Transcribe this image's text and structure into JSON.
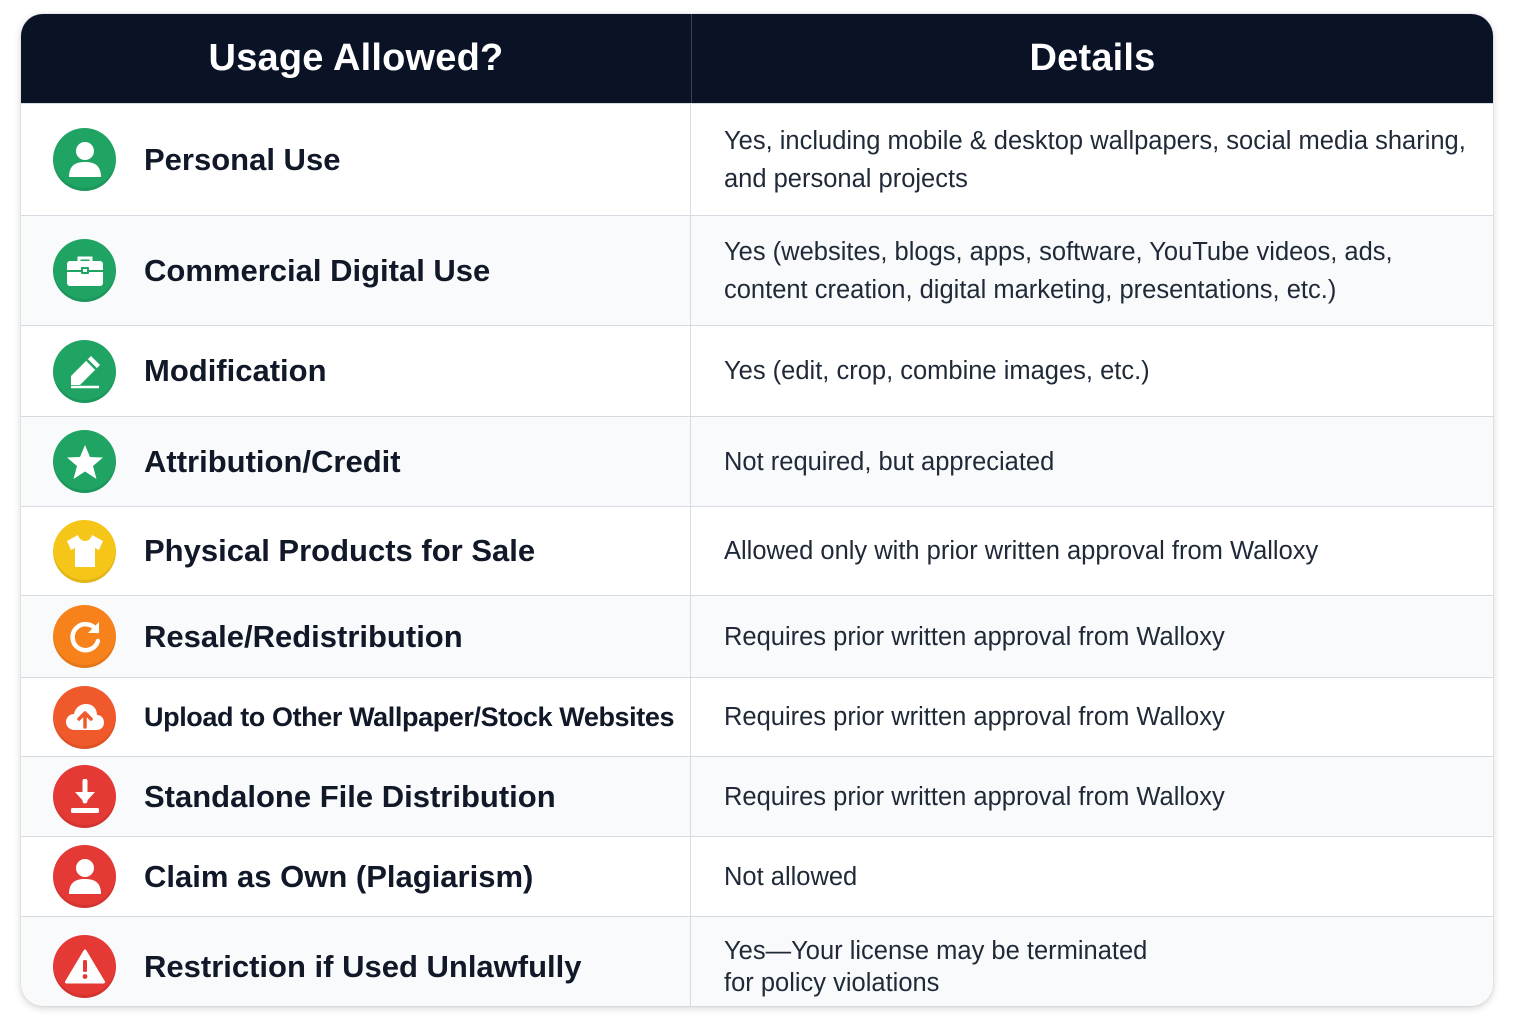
{
  "header": {
    "usage": "Usage Allowed?",
    "details": "Details"
  },
  "colors": {
    "header_bg": "#0a1226",
    "green": "#1fa463",
    "yellow": "#f5c518",
    "orange": "#f7821b",
    "orange_red": "#f0592b",
    "red": "#e53935"
  },
  "rows": [
    {
      "icon": "person-icon",
      "usage": "Personal Use",
      "details": "Yes, including mobile & desktop wallpapers, social media sharing, and personal projects"
    },
    {
      "icon": "briefcase-icon",
      "usage": "Commercial Digital Use",
      "details": "Yes (websites, blogs, apps, software, YouTube videos, ads, content creation, digital marketing, presentations, etc.)"
    },
    {
      "icon": "pencil-icon",
      "usage": "Modification",
      "details": "Yes (edit, crop, combine images, etc.)"
    },
    {
      "icon": "star-icon",
      "usage": "Attribution/Credit",
      "details": "Not required, but appreciated"
    },
    {
      "icon": "tshirt-icon",
      "usage": "Physical Products for Sale",
      "details": "Allowed only with prior written approval from Walloxy"
    },
    {
      "icon": "refresh-icon",
      "usage": "Resale/Redistribution",
      "details": "Requires prior written approval from Walloxy"
    },
    {
      "icon": "cloud-upload-icon",
      "usage": "Upload to Other Wallpaper/Stock Websites",
      "details": "Requires prior written approval from Walloxy"
    },
    {
      "icon": "download-icon",
      "usage": "Standalone File Distribution",
      "details": "Requires prior written approval from Walloxy"
    },
    {
      "icon": "person-icon",
      "usage": "Claim as Own (Plagiarism)",
      "details": "Not allowed"
    },
    {
      "icon": "warning-icon",
      "usage": "Restriction if Used Unlawfully",
      "details_line1": "Yes—Your license may be terminated",
      "details_line2": "for policy violations"
    }
  ]
}
